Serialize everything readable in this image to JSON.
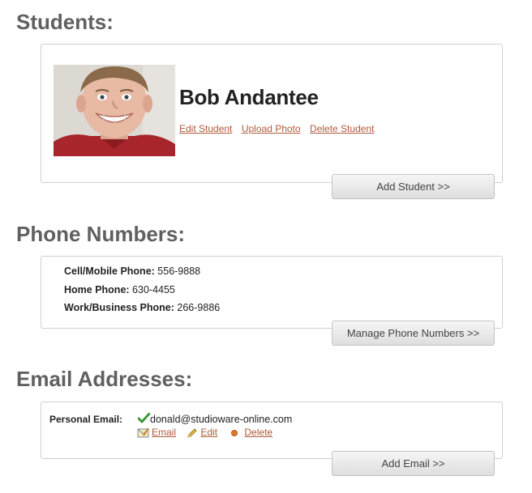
{
  "students": {
    "title": "Students:",
    "student": {
      "name": "Bob Andantee",
      "photo_icon": "student-photo"
    },
    "links": {
      "edit": "Edit Student",
      "upload": "Upload Photo",
      "delete": "Delete Student"
    },
    "add_button": "Add Student >>"
  },
  "phones": {
    "title": "Phone Numbers:",
    "items": [
      {
        "label": "Cell/Mobile Phone:",
        "value": "556-9888"
      },
      {
        "label": "Home Phone:",
        "value": "630-4455"
      },
      {
        "label": "Work/Business Phone:",
        "value": "266-9886"
      }
    ],
    "manage_button": "Manage Phone Numbers >>"
  },
  "emails": {
    "title": "Email Addresses:",
    "items": [
      {
        "label": "Personal Email:",
        "address": "donald@studioware-online.com",
        "verified_icon": "check-icon",
        "links": {
          "email": "Email",
          "edit": "Edit",
          "delete": "Delete"
        }
      }
    ],
    "add_button": "Add Email >>"
  },
  "colors": {
    "link": "#b05a3a",
    "heading": "#606060",
    "border": "#cfcfcf",
    "check": "#3a9a3a"
  }
}
